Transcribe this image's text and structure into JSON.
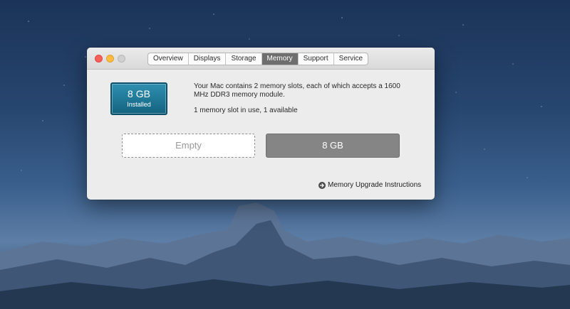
{
  "window": {
    "tabs": [
      {
        "label": "Overview"
      },
      {
        "label": "Displays"
      },
      {
        "label": "Storage"
      },
      {
        "label": "Memory",
        "active": true
      },
      {
        "label": "Support"
      },
      {
        "label": "Service"
      }
    ]
  },
  "memory": {
    "installed_size": "8 GB",
    "installed_label": "Installed",
    "description": "Your Mac contains 2 memory slots, each of which accepts a 1600 MHz DDR3 memory module.",
    "slot_status": "1 memory slot in use, 1 available",
    "slots": [
      {
        "label": "Empty",
        "state": "empty"
      },
      {
        "label": "8 GB",
        "state": "filled"
      }
    ],
    "upgrade_link": "Memory Upgrade Instructions",
    "upgrade_icon": "arrow-circle-right-icon"
  },
  "colors": {
    "installed_box": "#1f7a99",
    "active_tab": "#6e6e6e",
    "filled_slot": "#858585",
    "close": "#fc605b",
    "minimize": "#fdbc40"
  }
}
